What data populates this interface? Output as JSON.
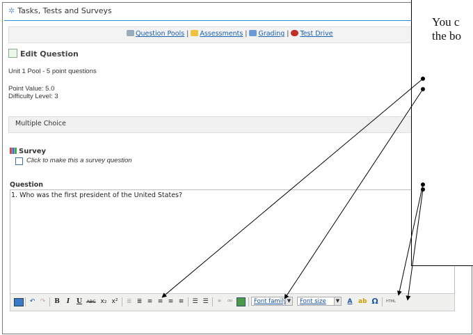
{
  "header": {
    "title": "Tasks, Tests and Surveys"
  },
  "nav": {
    "question_pools": "Question Pools",
    "assessments": "Assessments",
    "grading": "Grading",
    "test_drive": "Test Drive",
    "separator": "|"
  },
  "edit": {
    "heading": "Edit Question",
    "pool": "Unit 1 Pool - 5 point questions",
    "point_value": "Point Value: 5.0",
    "difficulty": "Difficulty Level: 3"
  },
  "question_type": "Multiple Choice",
  "survey": {
    "heading": "Survey",
    "checkbox_label": "Click to make this a survey question"
  },
  "question": {
    "label": "Question",
    "text": "1. Who was the first president of the United States?"
  },
  "toolbar": {
    "bold": "B",
    "italic": "I",
    "underline": "U",
    "strike": "ABC",
    "subscript": "x₂",
    "superscript": "x²",
    "font_family": "Font family",
    "font_size": "Font size",
    "text_color": "A",
    "special_char": "Ω",
    "html": "HTML"
  },
  "callout": {
    "line1": "You c",
    "line2": "the bo"
  }
}
